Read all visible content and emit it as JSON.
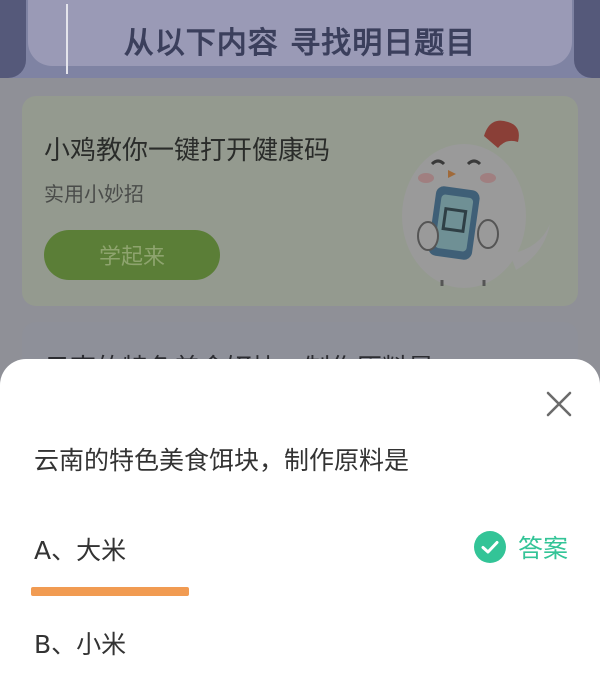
{
  "banner": {
    "title": "从以下内容 寻找明日题目"
  },
  "promo_card": {
    "title": "小鸡教你一键打开健康码",
    "subtitle": "实用小妙招",
    "button_label": "学起来"
  },
  "question_card": {
    "title_partial": "云南的特色美食饵块，制作原料是"
  },
  "sheet": {
    "question": "云南的特色美食饵块，制作原料是",
    "options": [
      {
        "label": "A、大米",
        "is_answer": true
      },
      {
        "label": "B、小米",
        "is_answer": false
      }
    ],
    "answer_label": "答案",
    "colors": {
      "answer": "#33c497",
      "highlight": "#f19b52"
    }
  }
}
